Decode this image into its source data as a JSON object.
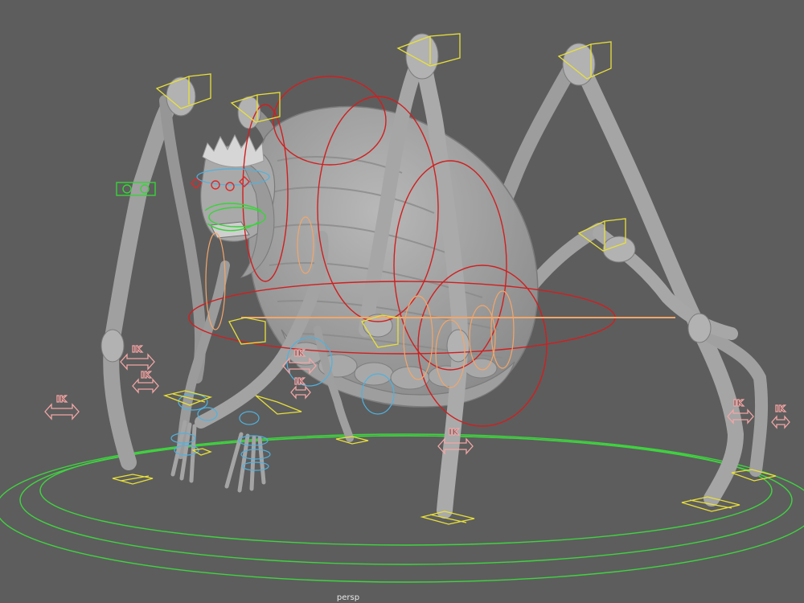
{
  "viewport": {
    "camera_name": "persp",
    "background": "#5d5d5d",
    "mesh_color": "#a9a9a9",
    "mesh_shade": "#8b8b8b"
  },
  "controls": {
    "ground_color": "#3fd43f",
    "spine_color": "#d01f1f",
    "limb_color": "#f2a66b",
    "hand_color": "#4fb2e0",
    "leg_box_color": "#e8e03a",
    "switch_color": "#f2a6a6",
    "face_green": "#38d438",
    "face_red": "#e02828"
  },
  "ik_switches": [
    {
      "id": "left-far",
      "label": "IK"
    },
    {
      "id": "left-near-a",
      "label": "IK"
    },
    {
      "id": "left-near-b",
      "label": "IK"
    },
    {
      "id": "center-a",
      "label": "IK"
    },
    {
      "id": "center-b",
      "label": "IK"
    },
    {
      "id": "front-right",
      "label": "IK"
    },
    {
      "id": "right-a",
      "label": "IK"
    },
    {
      "id": "right-b",
      "label": "IK"
    }
  ]
}
